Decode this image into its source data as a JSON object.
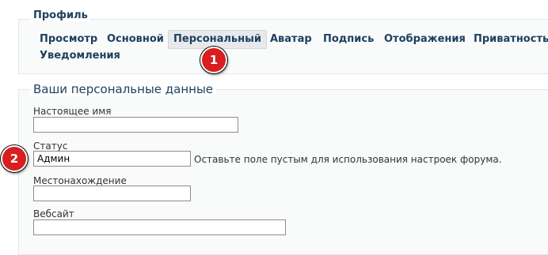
{
  "profile": {
    "title": "Профиль",
    "tabs": [
      {
        "label": "Просмотр"
      },
      {
        "label": "Основной"
      },
      {
        "label": "Персональный",
        "active": true
      },
      {
        "label": "Аватар"
      },
      {
        "label": "Подпись"
      },
      {
        "label": "Отображения"
      },
      {
        "label": "Приватность"
      },
      {
        "label": "Уведомления"
      }
    ]
  },
  "personal": {
    "legend": "Ваши персональные данные",
    "fields": {
      "real_name": {
        "label": "Настоящее имя",
        "value": ""
      },
      "status": {
        "label": "Статус",
        "value": "Админ",
        "hint": "Оставьте поле пустым для использования настроек форума."
      },
      "location": {
        "label": "Местонахождение",
        "value": ""
      },
      "website": {
        "label": "Вебсайт",
        "value": ""
      }
    }
  },
  "annotations": {
    "badge_1": "1",
    "badge_2": "2",
    "color": "#d81e1e"
  }
}
